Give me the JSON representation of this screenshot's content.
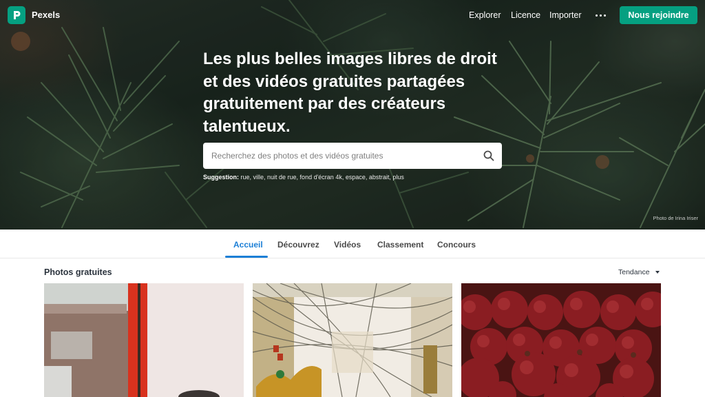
{
  "brand": {
    "name": "Pexels",
    "accent_color": "#05a081",
    "logo_icon": "pexels-logo-icon"
  },
  "nav": {
    "links": [
      "Explorer",
      "Licence",
      "Importer"
    ],
    "more_icon": "more-dots-icon",
    "join_label": "Nous rejoindre"
  },
  "hero": {
    "title": "Les plus belles images libres de droit et des vidéos gratuites partagées gratuitement par des créateurs talentueux.",
    "search_placeholder": "Recherchez des photos et des vidéos gratuites",
    "search_icon": "search-icon",
    "suggestion_label": "Suggestion:",
    "suggestions": "rue, ville, nuit de rue, fond d'écran 4k, espace, abstrait, plus",
    "photo_credit": "Photo de Irina Iriser"
  },
  "tabs": {
    "items": [
      "Accueil",
      "Découvrez",
      "Vidéos",
      "Classement",
      "Concours"
    ],
    "active": "Accueil",
    "active_color": "#1c7fd6"
  },
  "gallery": {
    "title": "Photos gratuites",
    "sort_label": "Tendance",
    "sort_icon": "caret-down-icon"
  }
}
